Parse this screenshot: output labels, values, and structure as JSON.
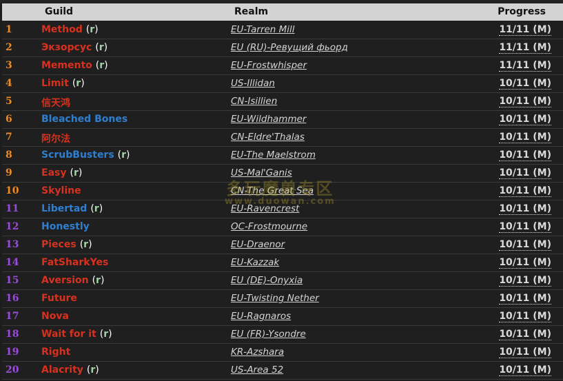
{
  "header": {
    "guild": "Guild",
    "realm": "Realm",
    "progress": "Progress"
  },
  "colors": {
    "rank_top10": "#f08a24",
    "rank_rest": "#9b4be0",
    "guild_red": "#d8311f",
    "guild_blue": "#2f7fd0",
    "recruit": "#9fd3a4"
  },
  "rows": [
    {
      "rank": "1",
      "guild": "Method",
      "recruiting": true,
      "realm": "EU-Tarren Mill",
      "progress": "11/11 (M)",
      "color": "#d8311f",
      "rank_color": "#f08a24"
    },
    {
      "rank": "2",
      "guild": "Экзорсус",
      "recruiting": true,
      "realm": "EU (RU)-Ревущий фьорд",
      "progress": "11/11 (M)",
      "color": "#d8311f",
      "rank_color": "#f08a24"
    },
    {
      "rank": "3",
      "guild": "Memento",
      "recruiting": true,
      "realm": "EU-Frostwhisper",
      "progress": "11/11 (M)",
      "color": "#d8311f",
      "rank_color": "#f08a24"
    },
    {
      "rank": "4",
      "guild": "Limit",
      "recruiting": true,
      "realm": "US-Illidan",
      "progress": "10/11 (M)",
      "color": "#d8311f",
      "rank_color": "#f08a24"
    },
    {
      "rank": "5",
      "guild": "信天鸿",
      "recruiting": false,
      "realm": "CN-Isillien",
      "progress": "10/11 (M)",
      "color": "#d8311f",
      "rank_color": "#f08a24"
    },
    {
      "rank": "6",
      "guild": "Bleached Bones",
      "recruiting": false,
      "realm": "EU-Wildhammer",
      "progress": "10/11 (M)",
      "color": "#2f7fd0",
      "rank_color": "#f08a24"
    },
    {
      "rank": "7",
      "guild": "阿尔法",
      "recruiting": false,
      "realm": "CN-Eldre'Thalas",
      "progress": "10/11 (M)",
      "color": "#d8311f",
      "rank_color": "#f08a24"
    },
    {
      "rank": "8",
      "guild": "ScrubBusters",
      "recruiting": true,
      "realm": "EU-The Maelstrom",
      "progress": "10/11 (M)",
      "color": "#2f7fd0",
      "rank_color": "#f08a24"
    },
    {
      "rank": "9",
      "guild": "Easy",
      "recruiting": true,
      "realm": "US-Mal'Ganis",
      "progress": "10/11 (M)",
      "color": "#d8311f",
      "rank_color": "#f08a24"
    },
    {
      "rank": "10",
      "guild": "Skyline",
      "recruiting": false,
      "realm": "CN-The Great Sea",
      "progress": "10/11 (M)",
      "color": "#d8311f",
      "rank_color": "#f08a24"
    },
    {
      "rank": "11",
      "guild": "Libertad",
      "recruiting": true,
      "realm": "EU-Ravencrest",
      "progress": "10/11 (M)",
      "color": "#2f7fd0",
      "rank_color": "#9b4be0"
    },
    {
      "rank": "12",
      "guild": "Honestly",
      "recruiting": false,
      "realm": "OC-Frostmourne",
      "progress": "10/11 (M)",
      "color": "#2f7fd0",
      "rank_color": "#9b4be0"
    },
    {
      "rank": "13",
      "guild": "Pieces",
      "recruiting": true,
      "realm": "EU-Draenor",
      "progress": "10/11 (M)",
      "color": "#d8311f",
      "rank_color": "#9b4be0"
    },
    {
      "rank": "14",
      "guild": "FatSharkYes",
      "recruiting": false,
      "realm": "EU-Kazzak",
      "progress": "10/11 (M)",
      "color": "#d8311f",
      "rank_color": "#9b4be0"
    },
    {
      "rank": "15",
      "guild": "Aversion",
      "recruiting": true,
      "realm": "EU (DE)-Onyxia",
      "progress": "10/11 (M)",
      "color": "#d8311f",
      "rank_color": "#9b4be0"
    },
    {
      "rank": "16",
      "guild": "Future",
      "recruiting": false,
      "realm": "EU-Twisting Nether",
      "progress": "10/11 (M)",
      "color": "#d8311f",
      "rank_color": "#9b4be0"
    },
    {
      "rank": "17",
      "guild": "Nova",
      "recruiting": false,
      "realm": "EU-Ragnaros",
      "progress": "10/11 (M)",
      "color": "#d8311f",
      "rank_color": "#9b4be0"
    },
    {
      "rank": "18",
      "guild": "Wait for it",
      "recruiting": true,
      "realm": "EU (FR)-Ysondre",
      "progress": "10/11 (M)",
      "color": "#d8311f",
      "rank_color": "#9b4be0"
    },
    {
      "rank": "19",
      "guild": "Right",
      "recruiting": false,
      "realm": "KR-Azshara",
      "progress": "10/11 (M)",
      "color": "#d8311f",
      "rank_color": "#9b4be0"
    },
    {
      "rank": "20",
      "guild": "Alacrity",
      "recruiting": true,
      "realm": "US-Area 52",
      "progress": "10/11 (M)",
      "color": "#d8311f",
      "rank_color": "#9b4be0"
    }
  ],
  "recruit_label": "r",
  "watermark": {
    "line1": "多玩魔兽专区",
    "line2": "www.duowan.com"
  }
}
